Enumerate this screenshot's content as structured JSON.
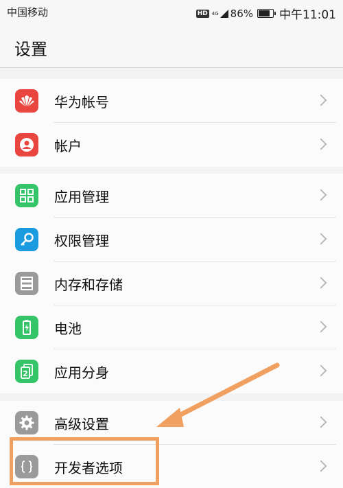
{
  "status_bar": {
    "carrier": "中国移动",
    "hd": "HD",
    "network": "4G",
    "battery": "86%",
    "time": "中午11:01",
    "battery_level": 0.86
  },
  "header": {
    "title": "设置"
  },
  "groups": [
    {
      "items": [
        {
          "label": "华为帐号",
          "icon": "huawei-logo-icon",
          "color": "#e8463f"
        },
        {
          "label": "帐户",
          "icon": "user-account-icon",
          "color": "#e8463f"
        }
      ]
    },
    {
      "items": [
        {
          "label": "应用管理",
          "icon": "apps-grid-icon",
          "color": "#35c467"
        },
        {
          "label": "权限管理",
          "icon": "key-icon",
          "color": "#1a9be0"
        },
        {
          "label": "内存和存储",
          "icon": "storage-icon",
          "color": "#9a9a9a"
        },
        {
          "label": "电池",
          "icon": "battery-icon",
          "color": "#35c467"
        },
        {
          "label": "应用分身",
          "icon": "app-twin-icon",
          "color": "#35c467"
        }
      ]
    },
    {
      "items": [
        {
          "label": "高级设置",
          "icon": "gear-icon",
          "color": "#9a9a9a"
        },
        {
          "label": "开发者选项",
          "icon": "developer-braces-icon",
          "color": "#9a9a9a"
        }
      ]
    }
  ],
  "annotation": {
    "color": "#f0a060"
  }
}
